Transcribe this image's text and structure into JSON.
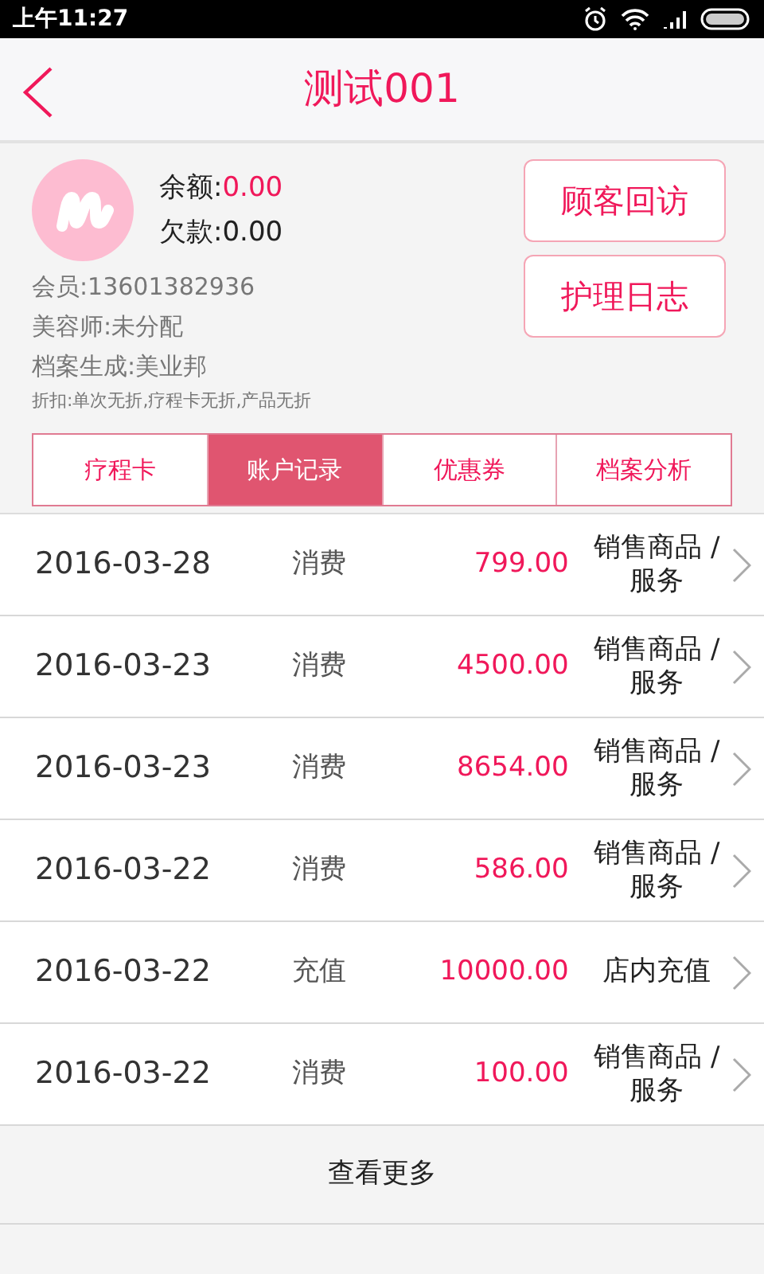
{
  "status_bar": {
    "time": "上午11:27"
  },
  "header": {
    "title": "测试001"
  },
  "profile": {
    "balance_label": "余额:",
    "balance": "0.00",
    "debt_label": "欠款:",
    "debt": "0.00",
    "details": [
      {
        "text": "会员:13601382936",
        "kind": "normal"
      },
      {
        "text": "美容师:未分配",
        "kind": "normal"
      },
      {
        "text": "档案生成:美业邦",
        "kind": "normal"
      },
      {
        "text": "折扣:单次无折,疗程卡无折,产品无折",
        "kind": "small"
      }
    ],
    "buttons": [
      "顾客回访",
      "护理日志"
    ]
  },
  "tabs": [
    {
      "label": "疗程卡",
      "selected": false
    },
    {
      "label": "账户记录",
      "selected": true
    },
    {
      "label": "优惠券",
      "selected": false
    },
    {
      "label": "档案分析",
      "selected": false
    }
  ],
  "records": [
    {
      "date": "2016-03-28",
      "type": "消费",
      "amount": "799.00",
      "note": "销售商品 / 服务"
    },
    {
      "date": "2016-03-23",
      "type": "消费",
      "amount": "4500.00",
      "note": "销售商品 / 服务"
    },
    {
      "date": "2016-03-23",
      "type": "消费",
      "amount": "8654.00",
      "note": "销售商品 / 服务"
    },
    {
      "date": "2016-03-22",
      "type": "消费",
      "amount": "586.00",
      "note": "销售商品 / 服务"
    },
    {
      "date": "2016-03-22",
      "type": "充值",
      "amount": "10000.00",
      "note": "店内充值"
    },
    {
      "date": "2016-03-22",
      "type": "消费",
      "amount": "100.00",
      "note": "销售商品 / 服务"
    }
  ],
  "more_link": "查看更多"
}
